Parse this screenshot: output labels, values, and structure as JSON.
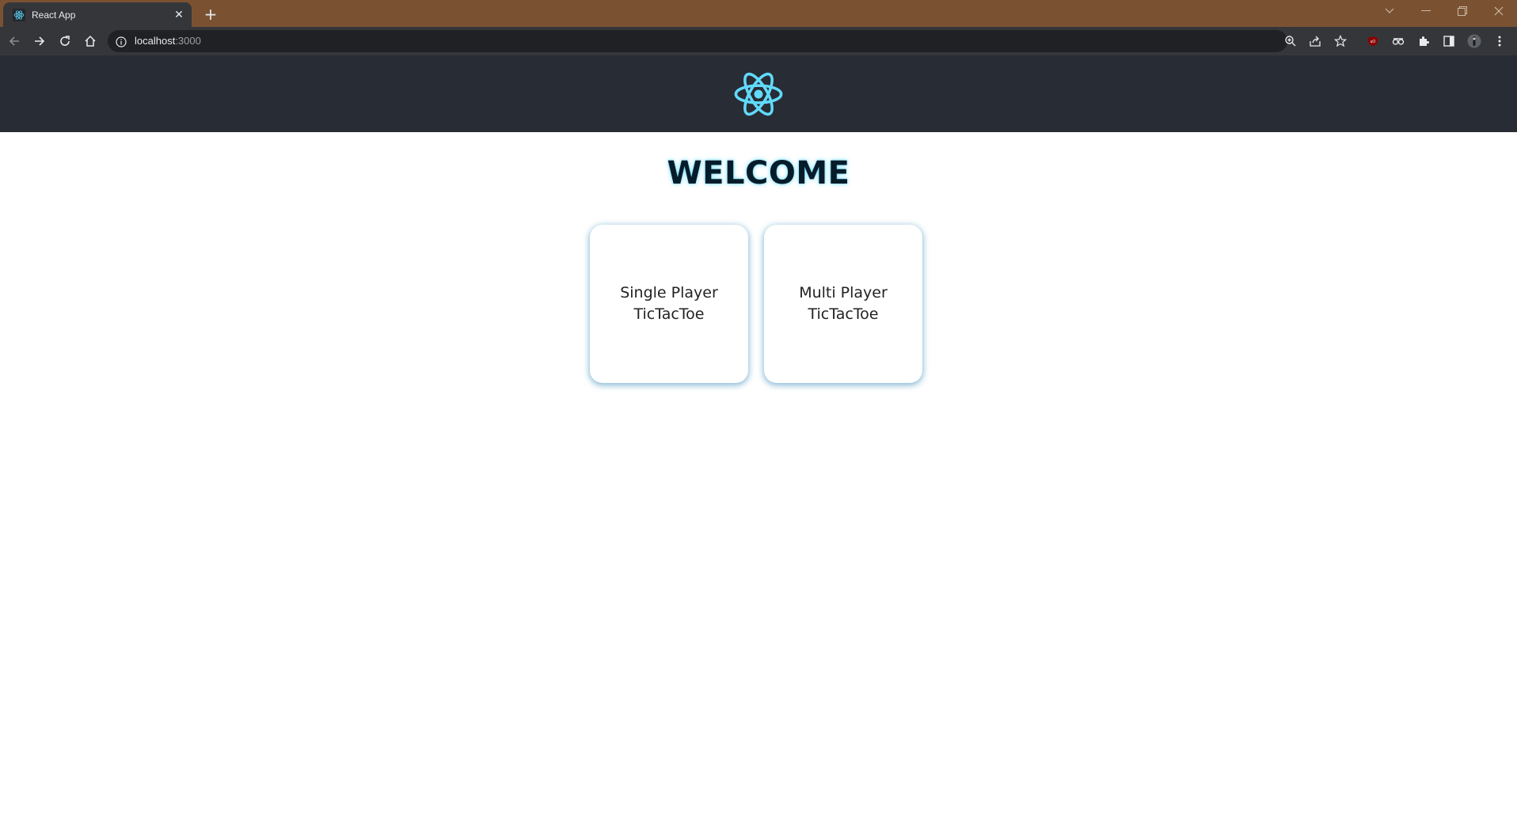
{
  "browser": {
    "tab_title": "React App",
    "url_host": "localhost",
    "url_port": ":3000"
  },
  "page": {
    "heading": "WELCOME",
    "cards": [
      {
        "line1": "Single Player",
        "line2": "TicTacToe"
      },
      {
        "line1": "Multi Player",
        "line2": "TicTacToe"
      }
    ]
  },
  "colors": {
    "header_bg": "#282c34",
    "react_blue": "#61dafb",
    "titlebar": "#7a5232"
  },
  "icons": [
    "react-logo-icon",
    "back-icon",
    "forward-icon",
    "reload-icon",
    "home-icon",
    "info-icon",
    "zoom-icon",
    "share-icon",
    "star-icon",
    "extensions-icon",
    "menu-icon"
  ]
}
